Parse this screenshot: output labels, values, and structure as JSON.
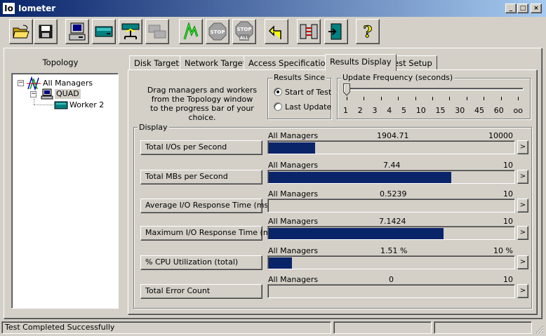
{
  "window": {
    "logo": "Io",
    "title": "Iometer",
    "minimize_label": "_",
    "maximize_label": "□",
    "close_label": "×"
  },
  "toolbar": {
    "buttons": [
      {
        "name": "open-config-icon"
      },
      {
        "name": "save-config-icon"
      },
      {
        "name": "new-manager-icon"
      },
      {
        "name": "new-disk-worker-icon"
      },
      {
        "name": "new-network-worker-icon"
      },
      {
        "name": "duplicate-worker-icon"
      },
      {
        "name": "start-tests-icon"
      },
      {
        "name": "stop-current-icon",
        "text": "STOP"
      },
      {
        "name": "stop-all-icon",
        "text": "STOP",
        "subtext": "ALL"
      },
      {
        "name": "reset-workers-icon"
      },
      {
        "name": "exit-manager-icon"
      },
      {
        "name": "exit-iometer-icon"
      },
      {
        "name": "about-icon",
        "text": "?"
      }
    ]
  },
  "topology": {
    "title": "Topology",
    "expander_minus": "−",
    "nodes": [
      {
        "label": "All Managers"
      },
      {
        "label": "QUAD"
      },
      {
        "label": "Worker 2"
      }
    ]
  },
  "tabs": [
    "Disk Targets",
    "Network Targets",
    "Access Specifications",
    "Results Display",
    "Test Setup"
  ],
  "active_tab": "Results Display",
  "instructions": [
    "Drag managers and workers",
    "from the Topology window",
    "to the progress bar of your choice."
  ],
  "results_since": {
    "title": "Results Since",
    "options": [
      {
        "label": "Start of Test",
        "checked": true
      },
      {
        "label": "Last Update",
        "checked": false
      }
    ]
  },
  "update_frequency": {
    "title": "Update Frequency (seconds)",
    "ticks": [
      "1",
      "2",
      "3",
      "4",
      "5",
      "10",
      "15",
      "30",
      "45",
      "60",
      "oo"
    ],
    "selected": "1"
  },
  "display": {
    "title": "Display",
    "more_label": ">",
    "rows": [
      {
        "label": "Total I/Os per Second",
        "source": "All Managers",
        "value": "1904.71",
        "max": "10000",
        "fill": 0.1905
      },
      {
        "label": "Total MBs per Second",
        "source": "All Managers",
        "value": "7.44",
        "max": "10",
        "fill": 0.744
      },
      {
        "label": "Average I/O Response Time (ms)",
        "source": "All Managers",
        "value": "0.5239",
        "max": "10",
        "fill": 0.0
      },
      {
        "label": "Maximum I/O Response Time (ms)",
        "source": "All Managers",
        "value": "7.1424",
        "max": "10",
        "fill": 0.7142
      },
      {
        "label": "% CPU Utilization (total)",
        "source": "All Managers",
        "value": "1.51 %",
        "max": "10 %",
        "fill": 0.0957
      },
      {
        "label": "Total Error Count",
        "source": "All Managers",
        "value": "0",
        "max": "10",
        "fill": 0.0
      }
    ]
  },
  "status_bar": {
    "text": "Test Completed Successfully"
  }
}
